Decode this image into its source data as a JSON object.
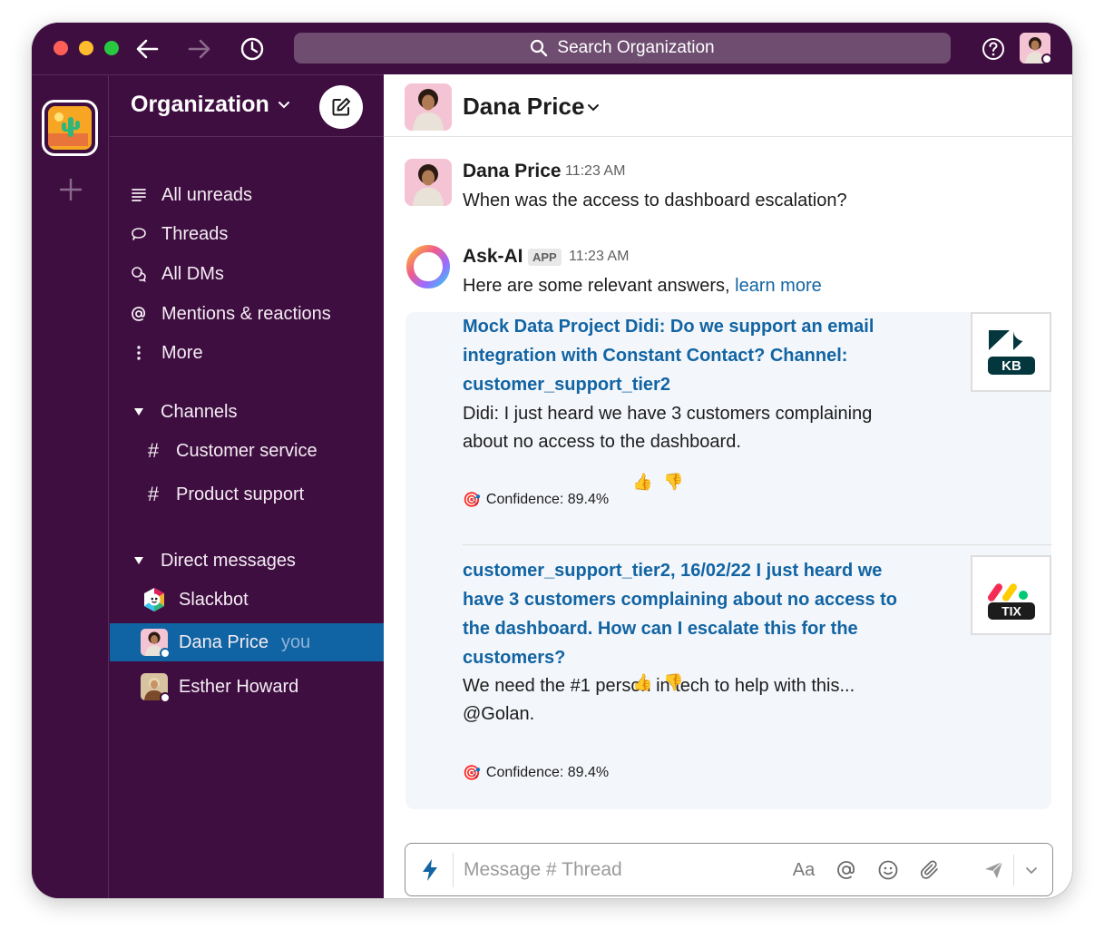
{
  "titlebar": {
    "search_placeholder": "Search Organization",
    "back_icon": "arrow-left-icon",
    "forward_icon": "arrow-right-icon",
    "history_icon": "clock-icon",
    "help_icon": "question-circle-icon"
  },
  "sidebar": {
    "org_name": "Organization",
    "nav": [
      {
        "label": "All unreads",
        "icon": "list-icon"
      },
      {
        "label": "Threads",
        "icon": "speech-bubble-icon"
      },
      {
        "label": "All DMs",
        "icon": "dm-bubbles-icon"
      },
      {
        "label": "Mentions & reactions",
        "icon": "at-sign-icon"
      },
      {
        "label": "More",
        "icon": "vertical-dots-icon"
      }
    ],
    "channels_label": "Channels",
    "channels": [
      "Customer service",
      "Product support"
    ],
    "dms_label": "Direct messages",
    "dms": [
      {
        "name": "Slackbot"
      },
      {
        "name": "Dana Price",
        "suffix": "you",
        "active": true
      },
      {
        "name": "Esther Howard"
      }
    ]
  },
  "header": {
    "name": "Dana Price"
  },
  "messages": [
    {
      "sender": "Dana Price",
      "time": "11:23 AM",
      "text": "When was the access to dashboard escalation?"
    },
    {
      "sender": "Ask-AI",
      "badge": "APP",
      "time": "11:23 AM",
      "text": "Here are some relevant answers, ",
      "link": "learn more"
    }
  ],
  "answers": [
    {
      "title": "Mock Data Project Didi: Do we support an email integration with Constant Contact? Channel: customer_support_tier2",
      "body": "Didi: I just heard we have 3 customers complaining about no access to the dashboard.",
      "confidence": "Confidence: 89.4%",
      "logo_label": "KB",
      "thumbs_up": "👍",
      "thumbs_down": "👎"
    },
    {
      "title": "customer_support_tier2, 16/02/22 I just heard we have 3 customers complaining about no access to the dashboard. How can I escalate this for the customers?",
      "body": "We need the #1 person in tech to help with this... @Golan.",
      "confidence": "Confidence: 89.4%",
      "logo_label": "TIX",
      "thumbs_up": "👍",
      "thumbs_down": "👎"
    }
  ],
  "composer": {
    "placeholder": "Message # Thread",
    "format_label": "Aa"
  },
  "colors": {
    "sidebar_bg": "#3f0e40",
    "active_item": "#1164a3",
    "link": "#1264a3",
    "answers_bg": "#f3f6fa"
  }
}
